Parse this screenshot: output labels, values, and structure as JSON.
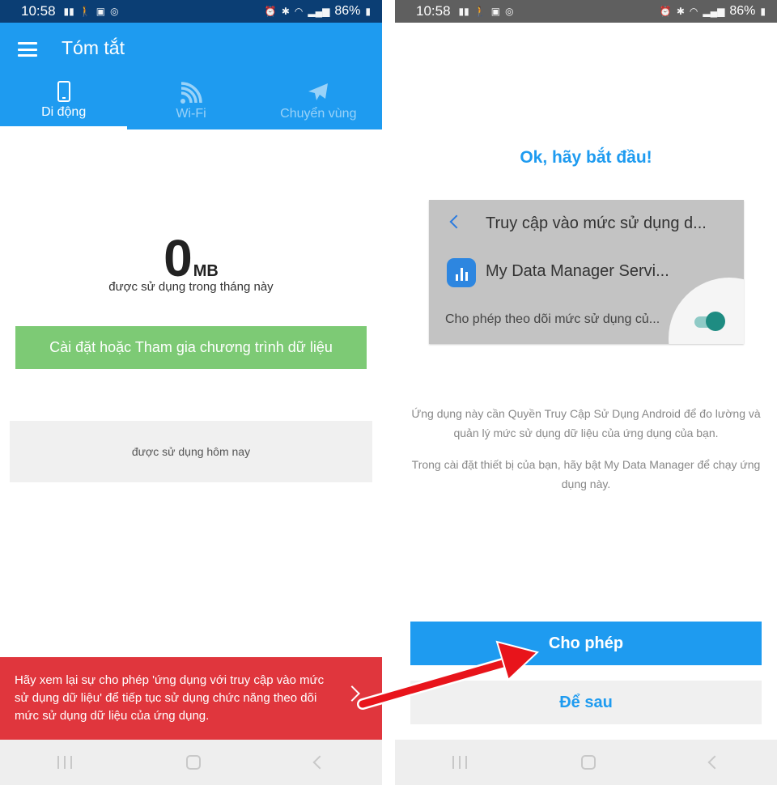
{
  "status_bar": {
    "left_time": "10:58",
    "left_battery": "86%",
    "right_time": "10:58",
    "right_battery": "86%",
    "icons": [
      "signal-icon",
      "walk-icon",
      "image-icon",
      "alarm-icon",
      "bluetooth-icon",
      "wifi-icon",
      "battery-icon"
    ]
  },
  "left": {
    "title": "Tóm tắt",
    "tabs": [
      {
        "label": "Di động",
        "icon": "phone-icon",
        "active": true
      },
      {
        "label": "Wi-Fi",
        "icon": "wifi-icon",
        "active": false
      },
      {
        "label": "Chuyển vùng",
        "icon": "airplane-icon",
        "active": false
      }
    ],
    "usage": {
      "value": "0",
      "unit": "MB",
      "caption": "được sử dụng trong tháng này"
    },
    "setup_button": "Cài đặt hoặc Tham gia chương trình dữ liệu",
    "today_label": "được sử dụng hôm nay",
    "banner": "Hãy xem lại sự cho phép 'ứng dụng với truy cập vào mức sử dụng dữ liệu' để tiếp tục sử dụng chức năng theo dõi mức sử dụng dữ liệu của ứng dụng."
  },
  "right": {
    "heading": "Ok, hãy bắt đầu!",
    "preview": {
      "title": "Truy cập vào mức sử dụng d...",
      "app_name": "My Data Manager Servi...",
      "toggle_label": "Cho phép theo dõi mức sử dụng củ...",
      "toggle_on": true
    },
    "para1": "Ứng dụng này cần Quyền Truy Cập Sử Dụng Android để đo lường và quản lý mức sử dụng dữ liệu của ứng dụng của bạn.",
    "para2": "Trong cài đặt thiết bị của bạn, hãy bật My Data Manager để chạy ứng dụng này.",
    "allow_button": "Cho phép",
    "later_button": "Để sau"
  },
  "colors": {
    "app_blue": "#1e9bf0",
    "status_dark": "#0b3e74",
    "status_gray": "#5f5f5f",
    "green": "#7dca75",
    "red": "#e0363d",
    "toggle_teal": "#1e8c82",
    "arrow_red": "#e8141b"
  }
}
